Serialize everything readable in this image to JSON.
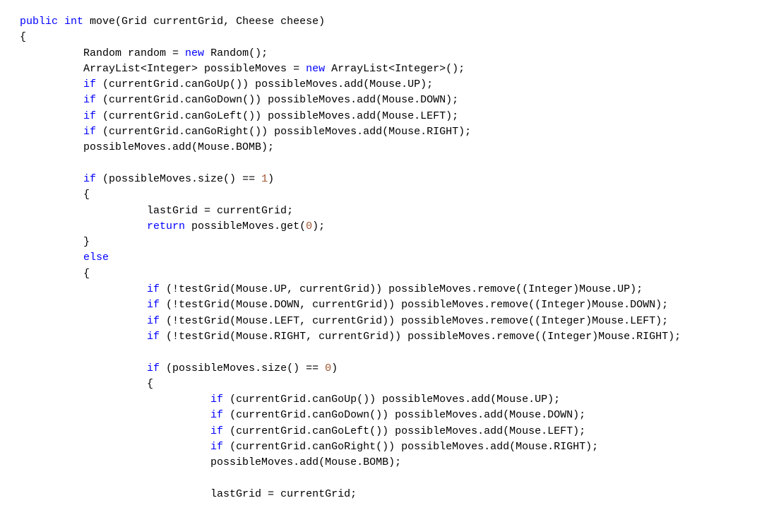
{
  "code": {
    "lines": [
      {
        "indent": 0,
        "tokens": [
          {
            "t": "public",
            "c": "kw"
          },
          {
            "t": " "
          },
          {
            "t": "int",
            "c": "kw"
          },
          {
            "t": " move(Grid currentGrid, Cheese cheese)"
          }
        ]
      },
      {
        "indent": 0,
        "tokens": [
          {
            "t": "{"
          }
        ]
      },
      {
        "indent": 2,
        "tokens": [
          {
            "t": "Random random = "
          },
          {
            "t": "new",
            "c": "kw"
          },
          {
            "t": " Random();"
          }
        ]
      },
      {
        "indent": 2,
        "tokens": [
          {
            "t": "ArrayList<Integer> possibleMoves = "
          },
          {
            "t": "new",
            "c": "kw"
          },
          {
            "t": " ArrayList<Integer>();"
          }
        ]
      },
      {
        "indent": 2,
        "tokens": [
          {
            "t": "if",
            "c": "kw"
          },
          {
            "t": " (currentGrid.canGoUp()) possibleMoves.add(Mouse.UP);"
          }
        ]
      },
      {
        "indent": 2,
        "tokens": [
          {
            "t": "if",
            "c": "kw"
          },
          {
            "t": " (currentGrid.canGoDown()) possibleMoves.add(Mouse.DOWN);"
          }
        ]
      },
      {
        "indent": 2,
        "tokens": [
          {
            "t": "if",
            "c": "kw"
          },
          {
            "t": " (currentGrid.canGoLeft()) possibleMoves.add(Mouse.LEFT);"
          }
        ]
      },
      {
        "indent": 2,
        "tokens": [
          {
            "t": "if",
            "c": "kw"
          },
          {
            "t": " (currentGrid.canGoRight()) possibleMoves.add(Mouse.RIGHT);"
          }
        ]
      },
      {
        "indent": 2,
        "tokens": [
          {
            "t": "possibleMoves.add(Mouse.BOMB);"
          }
        ]
      },
      {
        "indent": 2,
        "tokens": [
          {
            "t": ""
          }
        ]
      },
      {
        "indent": 2,
        "tokens": [
          {
            "t": "if",
            "c": "kw"
          },
          {
            "t": " (possibleMoves.size() == "
          },
          {
            "t": "1",
            "c": "num"
          },
          {
            "t": ")"
          }
        ]
      },
      {
        "indent": 2,
        "tokens": [
          {
            "t": "{"
          }
        ]
      },
      {
        "indent": 4,
        "tokens": [
          {
            "t": "lastGrid = currentGrid;"
          }
        ]
      },
      {
        "indent": 4,
        "tokens": [
          {
            "t": "return",
            "c": "kw"
          },
          {
            "t": " possibleMoves.get("
          },
          {
            "t": "0",
            "c": "num"
          },
          {
            "t": ");"
          }
        ]
      },
      {
        "indent": 2,
        "tokens": [
          {
            "t": "}"
          }
        ]
      },
      {
        "indent": 2,
        "tokens": [
          {
            "t": "else",
            "c": "kw"
          }
        ]
      },
      {
        "indent": 2,
        "tokens": [
          {
            "t": "{"
          }
        ]
      },
      {
        "indent": 4,
        "tokens": [
          {
            "t": "if",
            "c": "kw"
          },
          {
            "t": " (!testGrid(Mouse.UP, currentGrid)) possibleMoves.remove((Integer)Mouse.UP);"
          }
        ]
      },
      {
        "indent": 4,
        "tokens": [
          {
            "t": "if",
            "c": "kw"
          },
          {
            "t": " (!testGrid(Mouse.DOWN, currentGrid)) possibleMoves.remove((Integer)Mouse.DOWN);"
          }
        ]
      },
      {
        "indent": 4,
        "tokens": [
          {
            "t": "if",
            "c": "kw"
          },
          {
            "t": " (!testGrid(Mouse.LEFT, currentGrid)) possibleMoves.remove((Integer)Mouse.LEFT);"
          }
        ]
      },
      {
        "indent": 4,
        "tokens": [
          {
            "t": "if",
            "c": "kw"
          },
          {
            "t": " (!testGrid(Mouse.RIGHT, currentGrid)) possibleMoves.remove((Integer)Mouse.RIGHT);"
          }
        ]
      },
      {
        "indent": 4,
        "tokens": [
          {
            "t": ""
          }
        ]
      },
      {
        "indent": 4,
        "tokens": [
          {
            "t": "if",
            "c": "kw"
          },
          {
            "t": " (possibleMoves.size() == "
          },
          {
            "t": "0",
            "c": "num"
          },
          {
            "t": ")"
          }
        ]
      },
      {
        "indent": 4,
        "tokens": [
          {
            "t": "{"
          }
        ]
      },
      {
        "indent": 6,
        "tokens": [
          {
            "t": "if",
            "c": "kw"
          },
          {
            "t": " (currentGrid.canGoUp()) possibleMoves.add(Mouse.UP);"
          }
        ]
      },
      {
        "indent": 6,
        "tokens": [
          {
            "t": "if",
            "c": "kw"
          },
          {
            "t": " (currentGrid.canGoDown()) possibleMoves.add(Mouse.DOWN);"
          }
        ]
      },
      {
        "indent": 6,
        "tokens": [
          {
            "t": "if",
            "c": "kw"
          },
          {
            "t": " (currentGrid.canGoLeft()) possibleMoves.add(Mouse.LEFT);"
          }
        ]
      },
      {
        "indent": 6,
        "tokens": [
          {
            "t": "if",
            "c": "kw"
          },
          {
            "t": " (currentGrid.canGoRight()) possibleMoves.add(Mouse.RIGHT);"
          }
        ]
      },
      {
        "indent": 6,
        "tokens": [
          {
            "t": "possibleMoves.add(Mouse.BOMB);"
          }
        ]
      },
      {
        "indent": 6,
        "tokens": [
          {
            "t": ""
          }
        ]
      },
      {
        "indent": 6,
        "tokens": [
          {
            "t": "lastGrid = currentGrid;"
          }
        ]
      }
    ],
    "indent_unit": "     "
  }
}
